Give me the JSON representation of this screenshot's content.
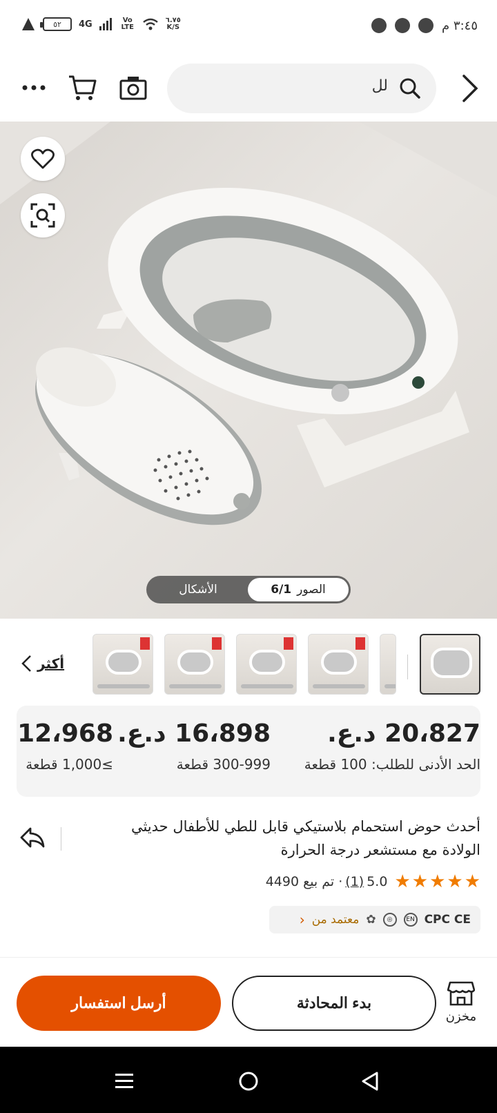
{
  "status_bar": {
    "time": "٣:٤٥ م",
    "battery": "٥٢",
    "network": "4G",
    "volte": "Vo LTE",
    "speed_value": "٦.٧٥",
    "speed_unit": "K/S"
  },
  "header": {
    "search_text": "لل"
  },
  "image_toggle": {
    "photos_label": "الصور",
    "photos_count": "6/1",
    "shapes_label": "الأشكال"
  },
  "thumbnails": {
    "more_label": "أكثر"
  },
  "prices": [
    {
      "price": "20،827 د.ع.",
      "quantity": "الحد الأدنى للطلب: 100 قطعة"
    },
    {
      "price": "16،898 د.ع.",
      "quantity": "300-999 قطعة"
    },
    {
      "price": "12،968",
      "quantity": "≥1,000 قطعة"
    }
  ],
  "product": {
    "title": "أحدث حوض استحمام بلاستيكي قابل للطي للأطفال حديثي الولادة مع مستشعر درجة الحرارة",
    "rating": "5.0",
    "reviews": "(1)",
    "sold": "· تم بيع 4490"
  },
  "certification": {
    "label": "معتمد من",
    "marks": "CPC CE"
  },
  "actions": {
    "store_label": "مخزن",
    "chat_label": "بدء المحادثة",
    "inquiry_label": "أرسل استفسار"
  },
  "colors": {
    "accent": "#e45000",
    "star": "#f07c00"
  }
}
